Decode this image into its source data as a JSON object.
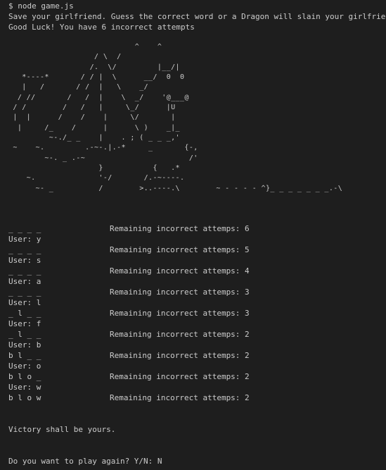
{
  "terminal": {
    "command": "$ node game.js",
    "intro_line1": "Save your girlfriend. Guess the correct word or a Dragon will slain your girlfriend",
    "intro_line2": "Good Luck! You have 6 incorrect attempts",
    "dragon_art": "                            ^    ^\n                   / \\  /\n                  /.  \\/         |__/|\n   *----*       / / |  \\      __/  0  0\n   |   /       / /  |   \\    _/\n  / //       /   /  |    \\  _/    '@___@\n / /        /   /   |     \\_/      |U\n |  |      /    /    |     \\/       |\n  |     /_    /      |      \\ )    _|_\n         ~-./_ _    |    . ; ( _ _ _,'\n ~    ~.         .-~-.|.-*     _       {-,\n        ~-. _ .-~                       /'\n                    }           {   .*\n    ~.              '-/       /.-~----.\n      ~- _          /        >..----.\\        ~ - - - - ^}_ _ _ _ _ _ _.-\\",
    "rounds": [
      {
        "word_state": "_ _ _ _",
        "remaining": "Remaining incorrect attemps: 6",
        "user_input": "User: y"
      },
      {
        "word_state": "_ _ _ _",
        "remaining": "Remaining incorrect attemps: 5",
        "user_input": "User: s"
      },
      {
        "word_state": "_ _ _ _",
        "remaining": "Remaining incorrect attemps: 4",
        "user_input": "User: a"
      },
      {
        "word_state": "_ _ _ _",
        "remaining": "Remaining incorrect attemps: 3",
        "user_input": "User: l"
      },
      {
        "word_state": "_ l _ _",
        "remaining": "Remaining incorrect attemps: 3",
        "user_input": "User: f"
      },
      {
        "word_state": "_ l _ _",
        "remaining": "Remaining incorrect attemps: 2",
        "user_input": "User: b"
      },
      {
        "word_state": "b l _ _",
        "remaining": "Remaining incorrect attemps: 2",
        "user_input": "User: o"
      },
      {
        "word_state": "b l o _",
        "remaining": "Remaining incorrect attemps: 2",
        "user_input": "User: w"
      },
      {
        "word_state": "b l o w",
        "remaining": "Remaining incorrect attemps: 2"
      }
    ],
    "victory": "Victory shall be yours.",
    "play_again_prompt": "Do you want to play again? Y/N: N"
  }
}
